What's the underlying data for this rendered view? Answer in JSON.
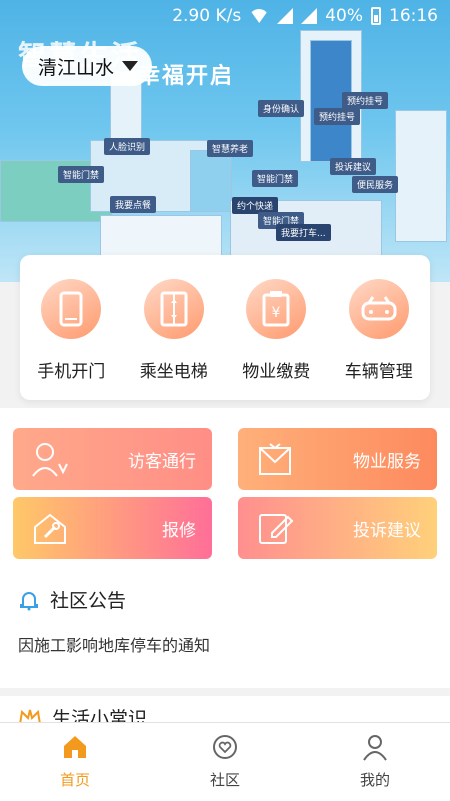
{
  "status_bar": {
    "speed": "2.90 K/s",
    "battery": "40%",
    "time": "16:16"
  },
  "hero": {
    "location": "清江山水",
    "slogan_main": "智慧生活",
    "slogan_sub": "幸福开启",
    "map_tags": [
      "身份确认",
      "预约挂号",
      "预约挂号",
      "人脸识别",
      "智慧养老",
      "智能门禁",
      "投诉建议",
      "智能门禁",
      "便民服务",
      "我要点餐",
      "约个快递",
      "智能门禁",
      "我要打车..."
    ]
  },
  "quick_actions": [
    {
      "label": "手机开门",
      "icon": "phone-icon"
    },
    {
      "label": "乘坐电梯",
      "icon": "elevator-icon"
    },
    {
      "label": "物业缴费",
      "icon": "bill-icon"
    },
    {
      "label": "车辆管理",
      "icon": "car-icon"
    }
  ],
  "service_tiles": [
    {
      "label": "访客通行",
      "icon": "visitor-icon"
    },
    {
      "label": "物业服务",
      "icon": "service-icon"
    },
    {
      "label": "报修",
      "icon": "repair-icon"
    },
    {
      "label": "投诉建议",
      "icon": "edit-icon"
    }
  ],
  "notice": {
    "title": "社区公告",
    "item": "因施工影响地库停车的通知",
    "icon": "bell-icon"
  },
  "tips": {
    "title": "生活小常识",
    "icon": "crown-icon"
  },
  "tabbar": {
    "active_color": "#f39a1e",
    "items": [
      {
        "label": "首页",
        "icon": "home-icon"
      },
      {
        "label": "社区",
        "icon": "community-icon"
      },
      {
        "label": "我的",
        "icon": "user-icon"
      }
    ]
  }
}
